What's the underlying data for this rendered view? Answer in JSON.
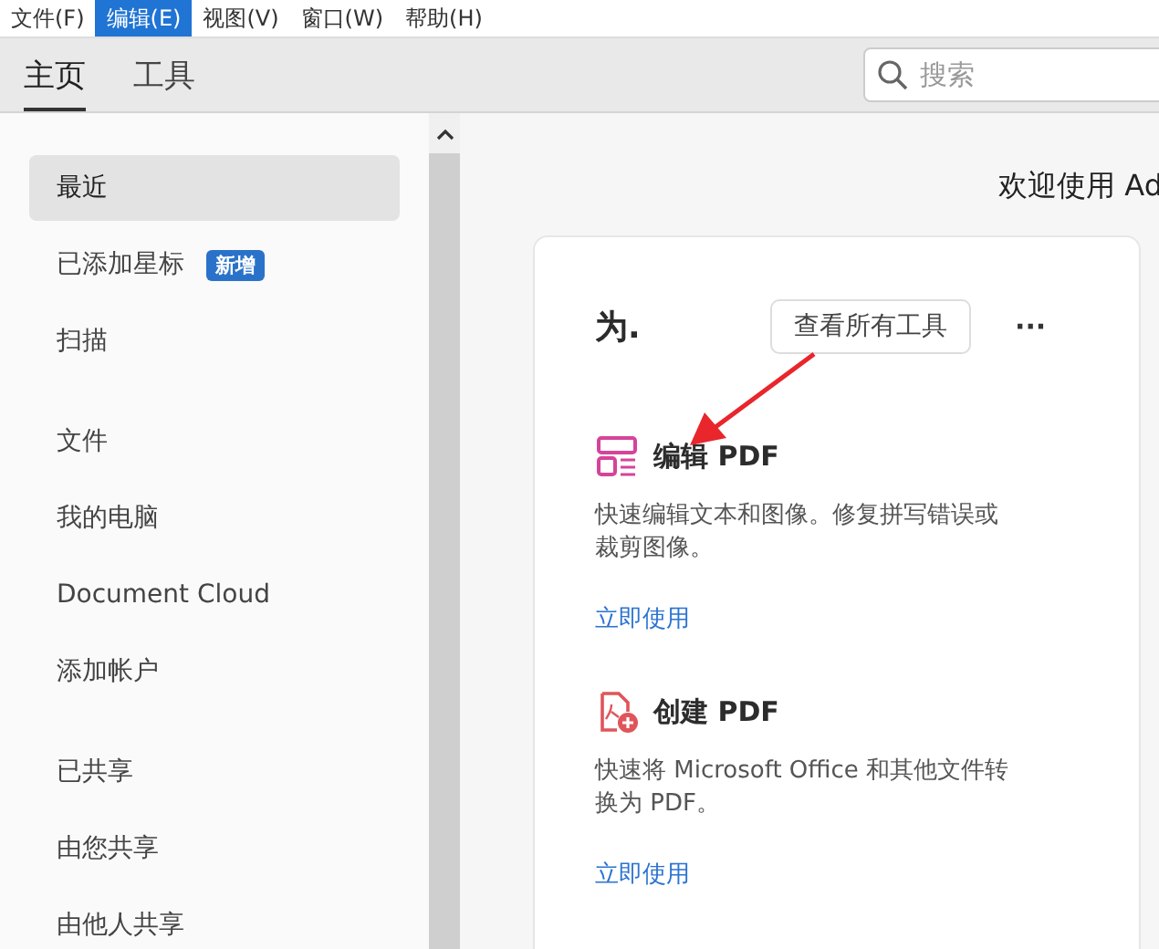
{
  "menu_bar": [
    {
      "label": "文件(F)",
      "selected": false
    },
    {
      "label": "编辑(E)",
      "selected": true
    },
    {
      "label": "视图(V)",
      "selected": false
    },
    {
      "label": "窗口(W)",
      "selected": false
    },
    {
      "label": "帮助(H)",
      "selected": false
    }
  ],
  "tabs": [
    {
      "label": "主页",
      "selected": true
    },
    {
      "label": "工具",
      "selected": false
    }
  ],
  "search": {
    "placeholder": "搜索"
  },
  "sidebar": {
    "sections": [
      {
        "items": [
          {
            "label": "最近",
            "selected": true
          },
          {
            "label": "已添加星标",
            "selected": false,
            "badge": "新增"
          },
          {
            "label": "扫描",
            "selected": false
          }
        ]
      },
      {
        "items": [
          {
            "label": "文件",
            "selected": false
          },
          {
            "label": "我的电脑",
            "selected": false
          },
          {
            "label": "Document Cloud",
            "selected": false
          },
          {
            "label": "添加帐户",
            "selected": false
          }
        ]
      },
      {
        "items": [
          {
            "label": "已共享",
            "selected": false
          },
          {
            "label": "由您共享",
            "selected": false
          },
          {
            "label": "由他人共享",
            "selected": false
          }
        ]
      }
    ]
  },
  "main": {
    "welcome": "欢迎使用 Ad",
    "card": {
      "title": "为.",
      "button": "查看所有工具",
      "more": "···",
      "tools": [
        {
          "kind": "edit",
          "title": "编辑 PDF",
          "description": "快速编辑文本和图像。修复拼写错误或裁剪图像。",
          "link": "立即使用"
        },
        {
          "kind": "create",
          "title": "创建 PDF",
          "description": "快速将 Microsoft Office 和其他文件转换为 PDF。",
          "link": "立即使用"
        }
      ]
    }
  },
  "annotation_arrow": true
}
